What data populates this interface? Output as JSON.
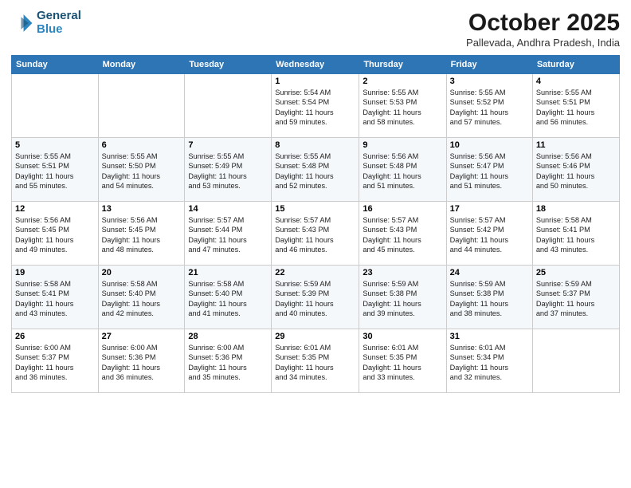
{
  "header": {
    "logo_line1": "General",
    "logo_line2": "Blue",
    "month": "October 2025",
    "location": "Pallevada, Andhra Pradesh, India"
  },
  "weekdays": [
    "Sunday",
    "Monday",
    "Tuesday",
    "Wednesday",
    "Thursday",
    "Friday",
    "Saturday"
  ],
  "weeks": [
    [
      {
        "day": "",
        "info": ""
      },
      {
        "day": "",
        "info": ""
      },
      {
        "day": "",
        "info": ""
      },
      {
        "day": "1",
        "info": "Sunrise: 5:54 AM\nSunset: 5:54 PM\nDaylight: 11 hours\nand 59 minutes."
      },
      {
        "day": "2",
        "info": "Sunrise: 5:55 AM\nSunset: 5:53 PM\nDaylight: 11 hours\nand 58 minutes."
      },
      {
        "day": "3",
        "info": "Sunrise: 5:55 AM\nSunset: 5:52 PM\nDaylight: 11 hours\nand 57 minutes."
      },
      {
        "day": "4",
        "info": "Sunrise: 5:55 AM\nSunset: 5:51 PM\nDaylight: 11 hours\nand 56 minutes."
      }
    ],
    [
      {
        "day": "5",
        "info": "Sunrise: 5:55 AM\nSunset: 5:51 PM\nDaylight: 11 hours\nand 55 minutes."
      },
      {
        "day": "6",
        "info": "Sunrise: 5:55 AM\nSunset: 5:50 PM\nDaylight: 11 hours\nand 54 minutes."
      },
      {
        "day": "7",
        "info": "Sunrise: 5:55 AM\nSunset: 5:49 PM\nDaylight: 11 hours\nand 53 minutes."
      },
      {
        "day": "8",
        "info": "Sunrise: 5:55 AM\nSunset: 5:48 PM\nDaylight: 11 hours\nand 52 minutes."
      },
      {
        "day": "9",
        "info": "Sunrise: 5:56 AM\nSunset: 5:48 PM\nDaylight: 11 hours\nand 51 minutes."
      },
      {
        "day": "10",
        "info": "Sunrise: 5:56 AM\nSunset: 5:47 PM\nDaylight: 11 hours\nand 51 minutes."
      },
      {
        "day": "11",
        "info": "Sunrise: 5:56 AM\nSunset: 5:46 PM\nDaylight: 11 hours\nand 50 minutes."
      }
    ],
    [
      {
        "day": "12",
        "info": "Sunrise: 5:56 AM\nSunset: 5:45 PM\nDaylight: 11 hours\nand 49 minutes."
      },
      {
        "day": "13",
        "info": "Sunrise: 5:56 AM\nSunset: 5:45 PM\nDaylight: 11 hours\nand 48 minutes."
      },
      {
        "day": "14",
        "info": "Sunrise: 5:57 AM\nSunset: 5:44 PM\nDaylight: 11 hours\nand 47 minutes."
      },
      {
        "day": "15",
        "info": "Sunrise: 5:57 AM\nSunset: 5:43 PM\nDaylight: 11 hours\nand 46 minutes."
      },
      {
        "day": "16",
        "info": "Sunrise: 5:57 AM\nSunset: 5:43 PM\nDaylight: 11 hours\nand 45 minutes."
      },
      {
        "day": "17",
        "info": "Sunrise: 5:57 AM\nSunset: 5:42 PM\nDaylight: 11 hours\nand 44 minutes."
      },
      {
        "day": "18",
        "info": "Sunrise: 5:58 AM\nSunset: 5:41 PM\nDaylight: 11 hours\nand 43 minutes."
      }
    ],
    [
      {
        "day": "19",
        "info": "Sunrise: 5:58 AM\nSunset: 5:41 PM\nDaylight: 11 hours\nand 43 minutes."
      },
      {
        "day": "20",
        "info": "Sunrise: 5:58 AM\nSunset: 5:40 PM\nDaylight: 11 hours\nand 42 minutes."
      },
      {
        "day": "21",
        "info": "Sunrise: 5:58 AM\nSunset: 5:40 PM\nDaylight: 11 hours\nand 41 minutes."
      },
      {
        "day": "22",
        "info": "Sunrise: 5:59 AM\nSunset: 5:39 PM\nDaylight: 11 hours\nand 40 minutes."
      },
      {
        "day": "23",
        "info": "Sunrise: 5:59 AM\nSunset: 5:38 PM\nDaylight: 11 hours\nand 39 minutes."
      },
      {
        "day": "24",
        "info": "Sunrise: 5:59 AM\nSunset: 5:38 PM\nDaylight: 11 hours\nand 38 minutes."
      },
      {
        "day": "25",
        "info": "Sunrise: 5:59 AM\nSunset: 5:37 PM\nDaylight: 11 hours\nand 37 minutes."
      }
    ],
    [
      {
        "day": "26",
        "info": "Sunrise: 6:00 AM\nSunset: 5:37 PM\nDaylight: 11 hours\nand 36 minutes."
      },
      {
        "day": "27",
        "info": "Sunrise: 6:00 AM\nSunset: 5:36 PM\nDaylight: 11 hours\nand 36 minutes."
      },
      {
        "day": "28",
        "info": "Sunrise: 6:00 AM\nSunset: 5:36 PM\nDaylight: 11 hours\nand 35 minutes."
      },
      {
        "day": "29",
        "info": "Sunrise: 6:01 AM\nSunset: 5:35 PM\nDaylight: 11 hours\nand 34 minutes."
      },
      {
        "day": "30",
        "info": "Sunrise: 6:01 AM\nSunset: 5:35 PM\nDaylight: 11 hours\nand 33 minutes."
      },
      {
        "day": "31",
        "info": "Sunrise: 6:01 AM\nSunset: 5:34 PM\nDaylight: 11 hours\nand 32 minutes."
      },
      {
        "day": "",
        "info": ""
      }
    ]
  ]
}
